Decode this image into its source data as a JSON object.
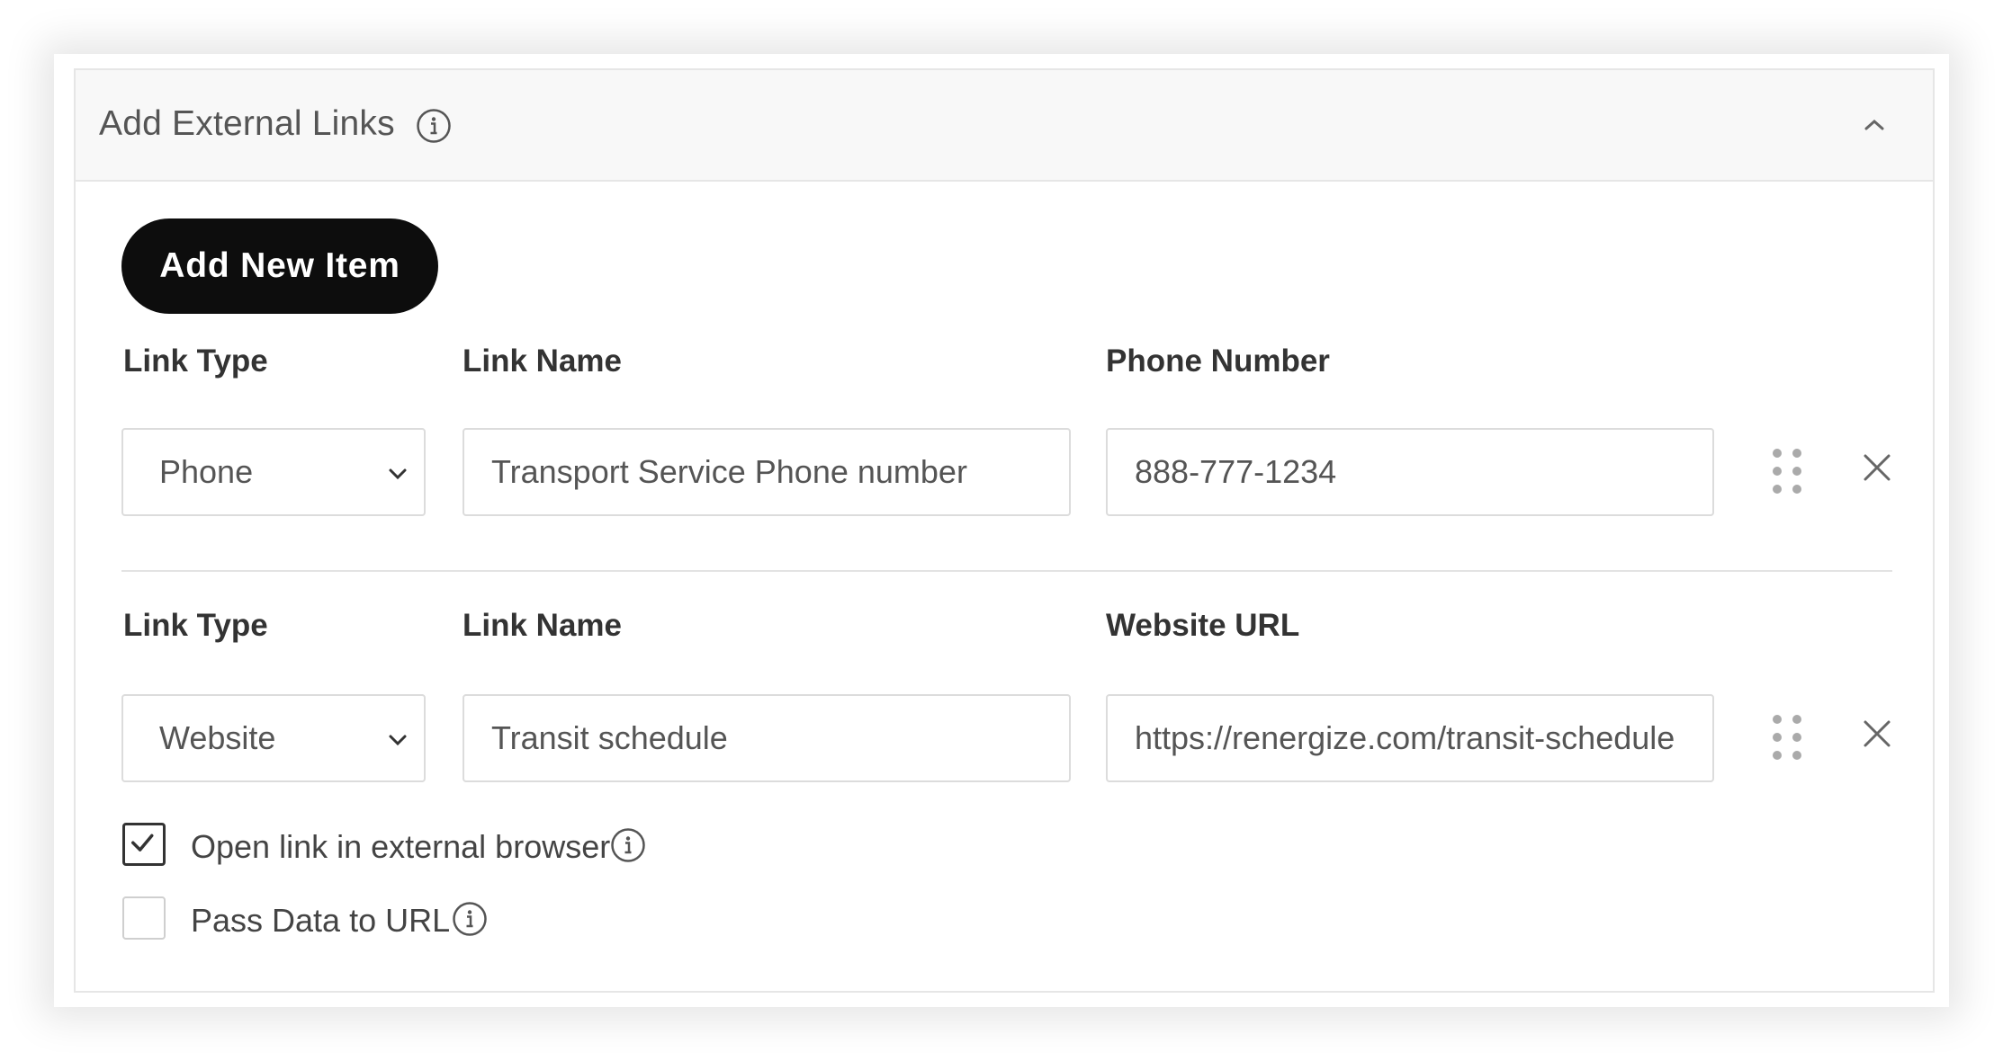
{
  "panel": {
    "title": "Add External Links",
    "add_button_label": "Add New Item"
  },
  "items": [
    {
      "link_type_label": "Link Type",
      "link_type_value": "Phone",
      "link_name_label": "Link Name",
      "link_name_value": "Transport Service Phone number",
      "target_label": "Phone Number",
      "target_value": "888-777-1234"
    },
    {
      "link_type_label": "Link Type",
      "link_type_value": "Website",
      "link_name_label": "Link Name",
      "link_name_value": "Transit schedule",
      "target_label": "Website URL",
      "target_value": "https://renergize.com/transit-schedule"
    }
  ],
  "options": {
    "open_external_label": "Open link in external browser",
    "open_external_checked": true,
    "pass_data_label": "Pass Data to URL",
    "pass_data_checked": false
  },
  "icons": {
    "info": "info-icon",
    "collapse": "chevron-up-icon",
    "dropdown": "chevron-down-icon",
    "drag": "drag-handle-icon",
    "remove": "close-icon",
    "check": "checkmark-icon"
  },
  "colors": {
    "button_bg": "#0d0d0d",
    "header_bg": "#f8f8f8",
    "border": "#dcdcdc"
  }
}
